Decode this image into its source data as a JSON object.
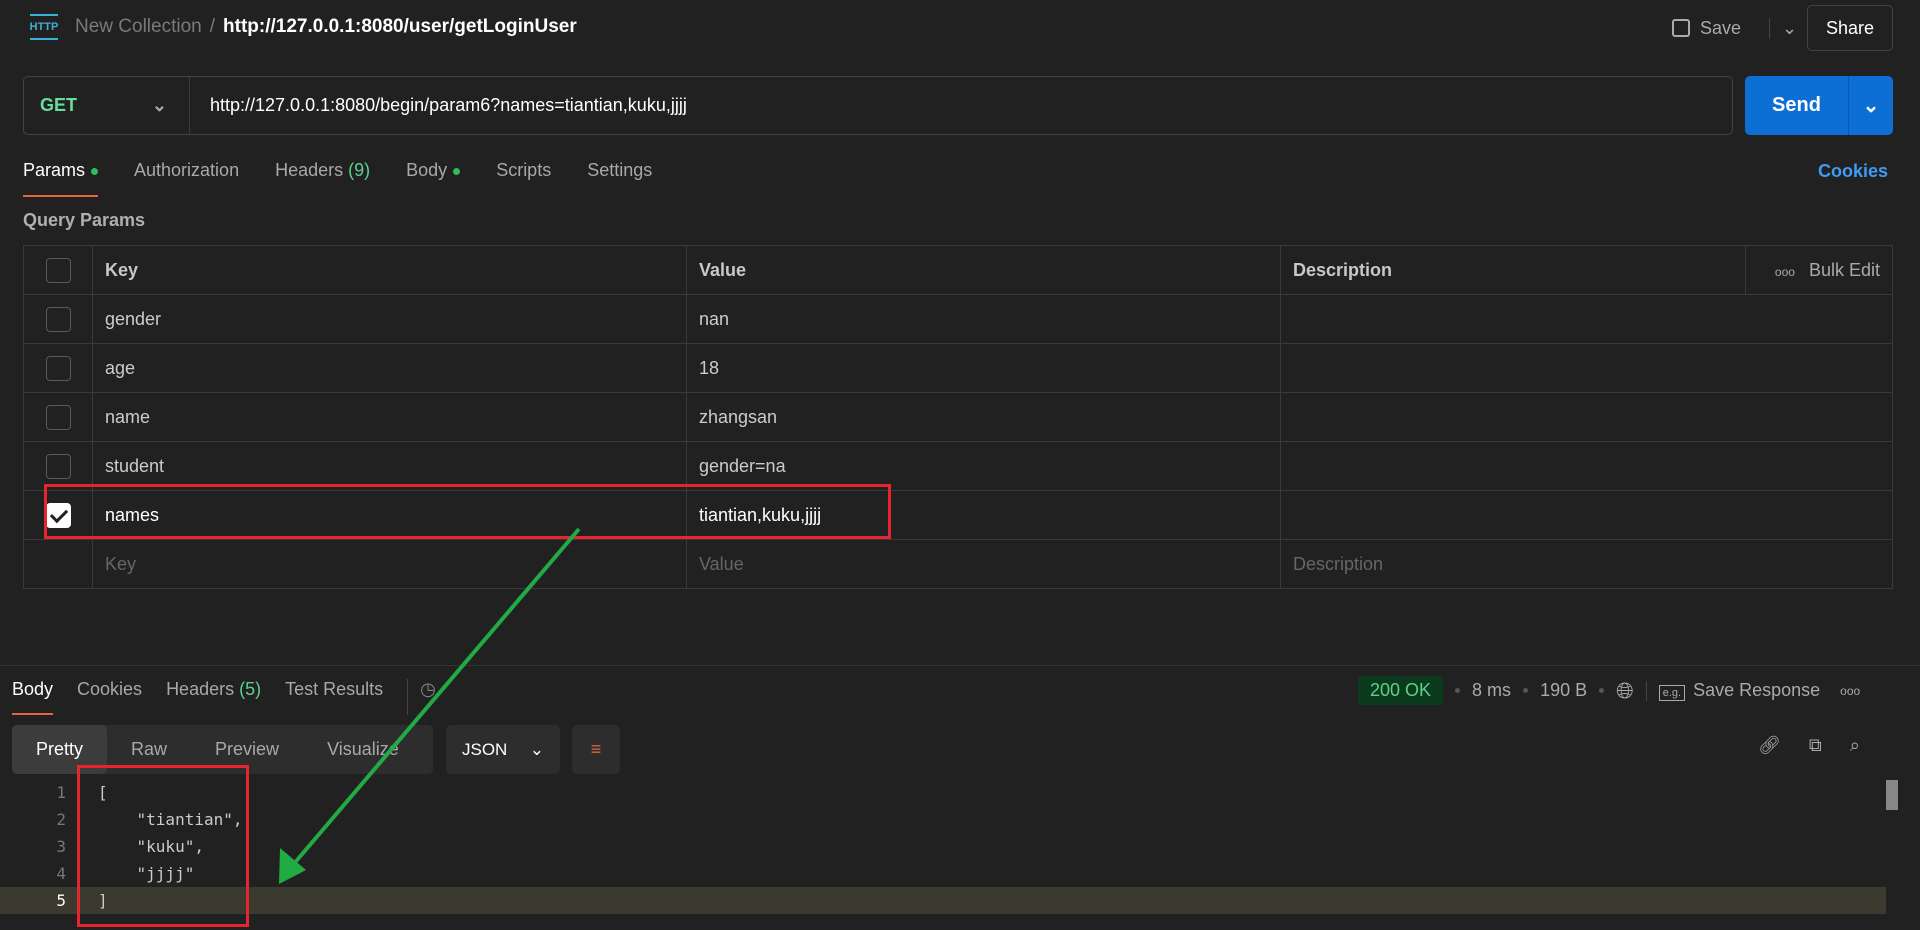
{
  "header": {
    "collection": "New Collection",
    "request_name": "http://127.0.0.1:8080/user/getLoginUser",
    "save_label": "Save",
    "share_label": "Share",
    "icon": "http-icon"
  },
  "request": {
    "method": "GET",
    "url": "http://127.0.0.1:8080/begin/param6?names=tiantian,kuku,jjjj",
    "send_label": "Send"
  },
  "tabs": [
    {
      "label": "Params",
      "dot": true
    },
    {
      "label": "Authorization"
    },
    {
      "label": "Headers",
      "count": "(9)"
    },
    {
      "label": "Body",
      "dot": true
    },
    {
      "label": "Scripts"
    },
    {
      "label": "Settings"
    }
  ],
  "cookies_label": "Cookies",
  "query_params": {
    "title": "Query Params",
    "headers": {
      "key": "Key",
      "value": "Value",
      "description": "Description",
      "bulk_edit": "Bulk Edit"
    },
    "rows": [
      {
        "key": "gender",
        "value": "nan",
        "checked": false
      },
      {
        "key": "age",
        "value": "18",
        "checked": false
      },
      {
        "key": "name",
        "value": "zhangsan",
        "checked": false
      },
      {
        "key": "student",
        "value": "gender=na",
        "checked": false
      },
      {
        "key": "names",
        "value": "tiantian,kuku,jjjj",
        "checked": true
      }
    ],
    "placeholder": {
      "key": "Key",
      "value": "Value",
      "description": "Description"
    }
  },
  "response": {
    "tabs": [
      {
        "label": "Body"
      },
      {
        "label": "Cookies"
      },
      {
        "label": "Headers",
        "count": "(5)"
      },
      {
        "label": "Test Results"
      }
    ],
    "status": "200 OK",
    "time": "8 ms",
    "size": "190 B",
    "save_response": "Save Response",
    "views": [
      "Pretty",
      "Raw",
      "Preview",
      "Visualize"
    ],
    "format": "JSON",
    "lines": [
      {
        "n": "1",
        "text": "["
      },
      {
        "n": "2",
        "text": "    \"tiantian\","
      },
      {
        "n": "3",
        "text": "    \"kuku\","
      },
      {
        "n": "4",
        "text": "    \"jjjj\""
      },
      {
        "n": "5",
        "text": "]"
      }
    ]
  },
  "colors": {
    "accent": "#e2673e",
    "send": "#0d6ed6",
    "annotation_box": "#e52530",
    "annotation_arrow": "#22aa44"
  }
}
